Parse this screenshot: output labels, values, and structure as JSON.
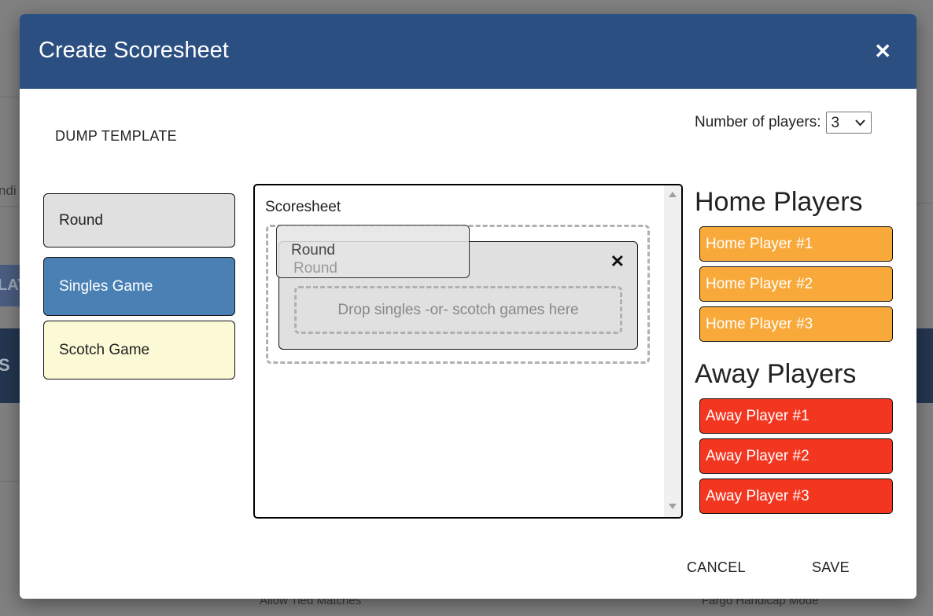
{
  "background": {
    "fragments": [
      "ndi",
      "LAY",
      "S"
    ],
    "labels": [
      "Allow Tied Matches",
      "Fargo Handicap Mode"
    ]
  },
  "modal": {
    "title": "Create Scoresheet",
    "close_icon": "close-icon",
    "dump_template": "DUMP TEMPLATE",
    "num_players_label": "Number of players:",
    "num_players_value": "3",
    "palette": [
      {
        "label": "Round",
        "color": "#e0e0e0"
      },
      {
        "label": "Singles Game",
        "color": "#4a80b4"
      },
      {
        "label": "Scotch Game",
        "color": "#fcf9d6"
      }
    ],
    "scoresheet": {
      "label": "Scoresheet",
      "round_label": "Round",
      "drag_ghost_label": "Round",
      "round_close_icon": "close-icon",
      "drop_hint": "Drop singles -or- scotch games here"
    },
    "home_title": "Home Players",
    "home_players": [
      "Home Player #1",
      "Home Player #2",
      "Home Player #3"
    ],
    "away_title": "Away Players",
    "away_players": [
      "Away Player #1",
      "Away Player #2",
      "Away Player #3"
    ],
    "home_color": "#f8a93a",
    "away_color": "#f33620",
    "cancel": "CANCEL",
    "save": "SAVE"
  }
}
